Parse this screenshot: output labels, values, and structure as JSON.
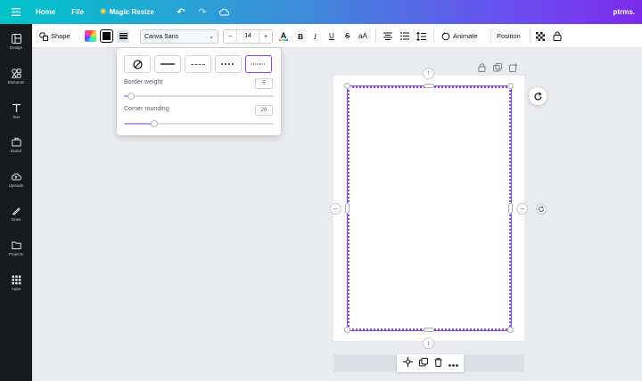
{
  "topbar": {
    "home": "Home",
    "file": "File",
    "magic_resize": "Magic Resize",
    "brand": "ptrms."
  },
  "sidebar": {
    "items": [
      {
        "label": "Design",
        "icon": "layout-icon"
      },
      {
        "label": "Elements",
        "icon": "shapes-icon"
      },
      {
        "label": "Text",
        "icon": "text-icon"
      },
      {
        "label": "Brand",
        "icon": "briefcase-icon"
      },
      {
        "label": "Uploads",
        "icon": "cloud-upload-icon"
      },
      {
        "label": "Draw",
        "icon": "pen-icon"
      },
      {
        "label": "Projects",
        "icon": "folder-icon"
      },
      {
        "label": "Apps",
        "icon": "grid-icon"
      }
    ]
  },
  "toolbar": {
    "shape": "Shape",
    "font": "Canva Sans",
    "font_size": "14",
    "minus": "−",
    "plus": "+",
    "bold": "B",
    "italic": "I",
    "underline": "U",
    "strike": "S",
    "case": "aA",
    "animate": "Animate",
    "position": "Position",
    "colors": {
      "accent": "#8b3dff",
      "shape_fill": "#000000"
    }
  },
  "border_panel": {
    "border_weight_label": "Border weight",
    "border_weight_value": "5",
    "corner_rounding_label": "Corner rounding",
    "corner_rounding_value": "20",
    "border_weight_fraction": 0.05,
    "corner_rounding_fraction": 0.2,
    "selected_style": "dotted"
  }
}
